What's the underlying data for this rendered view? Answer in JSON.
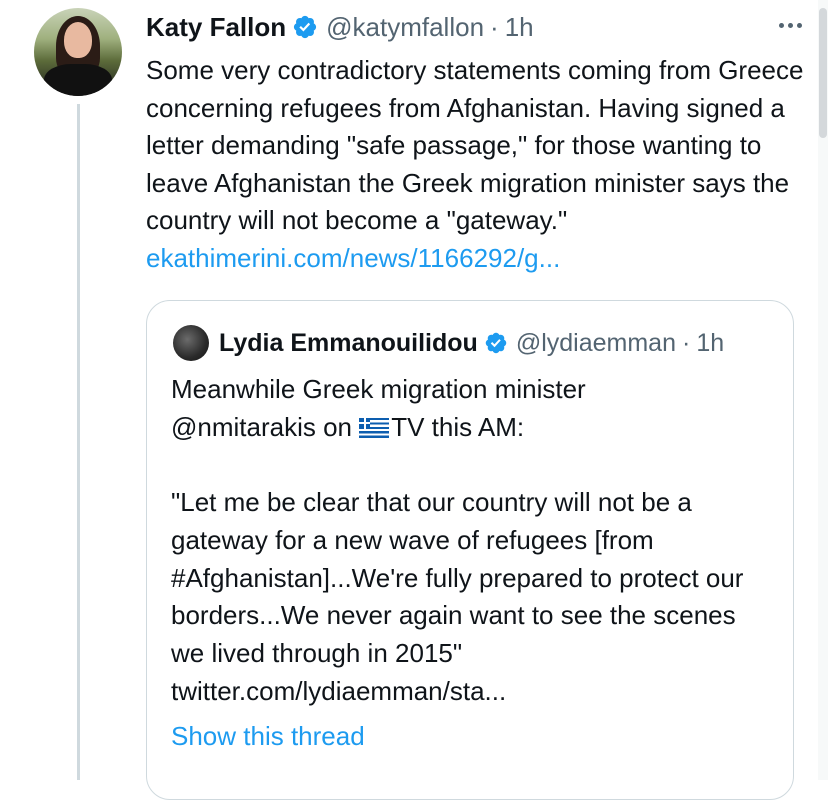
{
  "tweet": {
    "author_name": "Katy Fallon",
    "author_handle": "@katymfallon",
    "separator": "·",
    "time": "1h",
    "text": "Some very contradictory statements coming from Greece concerning refugees from Afghanistan. Having signed a letter demanding \"safe passage,\" for those wanting to leave Afghanistan the Greek migration minister says the country will not become a \"gateway.\" ",
    "link": "ekathimerini.com/news/1166292/g..."
  },
  "quote": {
    "author_name": "Lydia Emmanouilidou",
    "author_handle": "@lydiaemman",
    "separator": "·",
    "time": "1h",
    "text_before_flag": "Meanwhile Greek migration minister\n@nmitarakis on ",
    "text_after_flag": "TV this AM:\n\n\"Let me be clear that our country will not be a gateway for a new wave of refugees [from #Afghanistan]...We're fully prepared to protect our borders...We never again want to see the scenes we lived through in 2015\"\ntwitter.com/lydiaemman/sta...",
    "show_thread": "Show this thread"
  },
  "colors": {
    "accent": "#1d9bf0",
    "text": "#0f1419",
    "secondary": "#536471",
    "border": "#cfd9de"
  },
  "icons": {
    "verified": "verified-badge-icon",
    "more": "more-horizontal-icon",
    "flag": "greek-flag-emoji"
  }
}
